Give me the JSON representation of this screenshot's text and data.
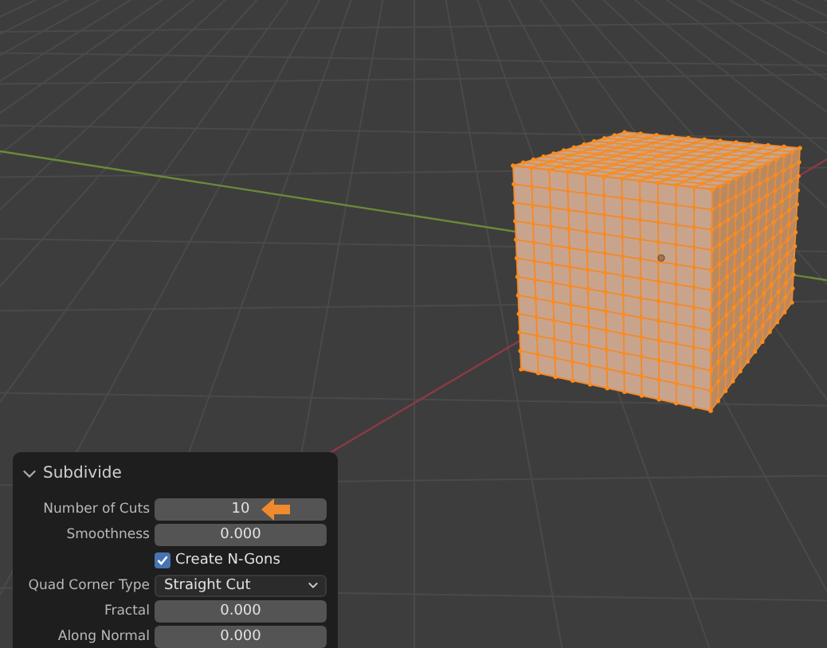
{
  "operator_panel": {
    "title": "Subdivide",
    "expanded": true,
    "rows": [
      {
        "kind": "number",
        "label": "Number of Cuts",
        "value": "10"
      },
      {
        "kind": "number",
        "label": "Smoothness",
        "value": "0.000"
      },
      {
        "kind": "checkbox",
        "label": "Create N-Gons",
        "checked": true
      },
      {
        "kind": "dropdown",
        "label": "Quad Corner Type",
        "value": "Straight Cut"
      },
      {
        "kind": "number",
        "label": "Fractal",
        "value": "0.000"
      },
      {
        "kind": "number",
        "label": "Along Normal",
        "value": "0.000"
      }
    ]
  }
}
